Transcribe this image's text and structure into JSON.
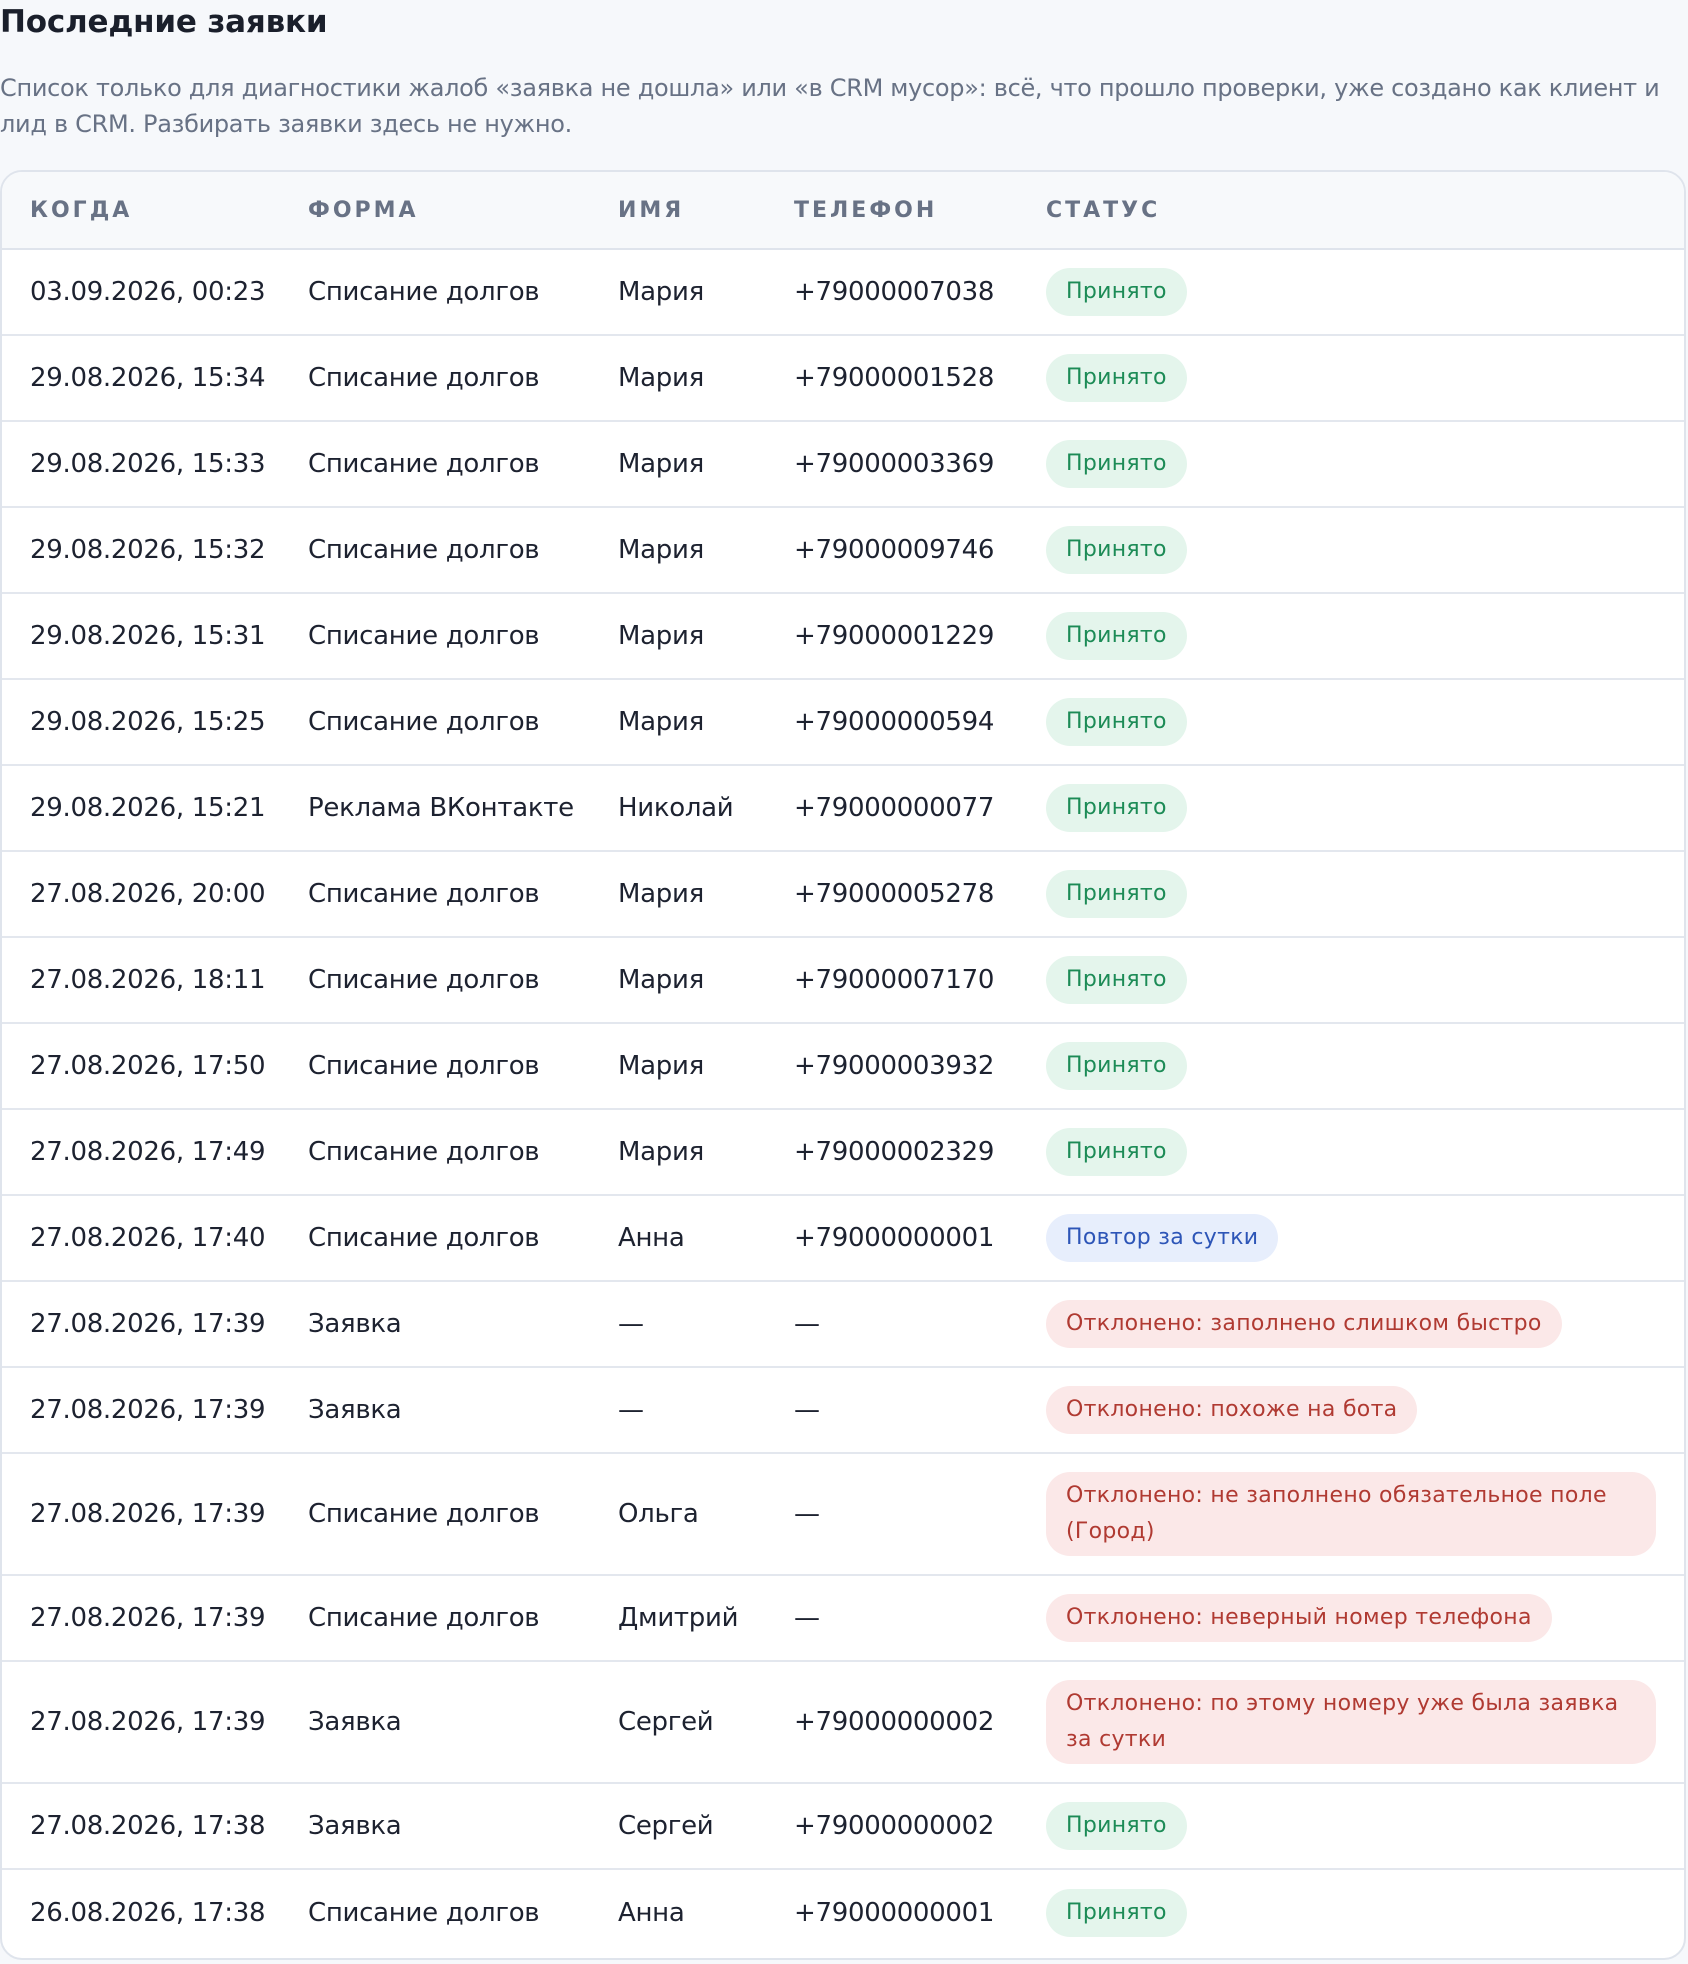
{
  "header": {
    "title": "Последние заявки",
    "description": "Список только для диагностики жалоб «заявка не дошла» или «в CRM мусор»: всё, что прошло проверки, уже создано как клиент и лид в CRM. Разбирать заявки здесь не нужно."
  },
  "table": {
    "columns": [
      "КОГДА",
      "ФОРМА",
      "ИМЯ",
      "ТЕЛЕФОН",
      "СТАТУС"
    ],
    "rows": [
      {
        "when": "03.09.2026, 00:23",
        "form": "Списание долгов",
        "name": "Мария",
        "phone": "+79000007038",
        "status": "Принято",
        "status_type": "accepted"
      },
      {
        "when": "29.08.2026, 15:34",
        "form": "Списание долгов",
        "name": "Мария",
        "phone": "+79000001528",
        "status": "Принято",
        "status_type": "accepted"
      },
      {
        "when": "29.08.2026, 15:33",
        "form": "Списание долгов",
        "name": "Мария",
        "phone": "+79000003369",
        "status": "Принято",
        "status_type": "accepted"
      },
      {
        "when": "29.08.2026, 15:32",
        "form": "Списание долгов",
        "name": "Мария",
        "phone": "+79000009746",
        "status": "Принято",
        "status_type": "accepted"
      },
      {
        "when": "29.08.2026, 15:31",
        "form": "Списание долгов",
        "name": "Мария",
        "phone": "+79000001229",
        "status": "Принято",
        "status_type": "accepted"
      },
      {
        "when": "29.08.2026, 15:25",
        "form": "Списание долгов",
        "name": "Мария",
        "phone": "+79000000594",
        "status": "Принято",
        "status_type": "accepted"
      },
      {
        "when": "29.08.2026, 15:21",
        "form": "Реклама ВКонтакте",
        "name": "Николай",
        "phone": "+79000000077",
        "status": "Принято",
        "status_type": "accepted"
      },
      {
        "when": "27.08.2026, 20:00",
        "form": "Списание долгов",
        "name": "Мария",
        "phone": "+79000005278",
        "status": "Принято",
        "status_type": "accepted"
      },
      {
        "when": "27.08.2026, 18:11",
        "form": "Списание долгов",
        "name": "Мария",
        "phone": "+79000007170",
        "status": "Принято",
        "status_type": "accepted"
      },
      {
        "when": "27.08.2026, 17:50",
        "form": "Списание долгов",
        "name": "Мария",
        "phone": "+79000003932",
        "status": "Принято",
        "status_type": "accepted"
      },
      {
        "when": "27.08.2026, 17:49",
        "form": "Списание долгов",
        "name": "Мария",
        "phone": "+79000002329",
        "status": "Принято",
        "status_type": "accepted"
      },
      {
        "when": "27.08.2026, 17:40",
        "form": "Списание долгов",
        "name": "Анна",
        "phone": "+79000000001",
        "status": "Повтор за сутки",
        "status_type": "repeat"
      },
      {
        "when": "27.08.2026, 17:39",
        "form": "Заявка",
        "name": "—",
        "phone": "—",
        "status": "Отклонено: заполнено слишком быстро",
        "status_type": "rejected"
      },
      {
        "when": "27.08.2026, 17:39",
        "form": "Заявка",
        "name": "—",
        "phone": "—",
        "status": "Отклонено: похоже на бота",
        "status_type": "rejected"
      },
      {
        "when": "27.08.2026, 17:39",
        "form": "Списание долгов",
        "name": "Ольга",
        "phone": "—",
        "status": "Отклонено: не заполнено обязательное поле (Город)",
        "status_type": "rejected",
        "tall": true
      },
      {
        "when": "27.08.2026, 17:39",
        "form": "Списание долгов",
        "name": "Дмитрий",
        "phone": "—",
        "status": "Отклонено: неверный номер телефона",
        "status_type": "rejected"
      },
      {
        "when": "27.08.2026, 17:39",
        "form": "Заявка",
        "name": "Сергей",
        "phone": "+79000000002",
        "status": "Отклонено: по этому номеру уже была заявка за сутки",
        "status_type": "rejected",
        "tall": true
      },
      {
        "when": "27.08.2026, 17:38",
        "form": "Заявка",
        "name": "Сергей",
        "phone": "+79000000002",
        "status": "Принято",
        "status_type": "accepted"
      },
      {
        "when": "26.08.2026, 17:38",
        "form": "Списание долгов",
        "name": "Анна",
        "phone": "+79000000001",
        "status": "Принято",
        "status_type": "accepted"
      }
    ]
  },
  "colors": {
    "accepted_bg": "#e4f5ec",
    "accepted_text": "#1c8b56",
    "repeat_bg": "#e7eefc",
    "repeat_text": "#2d55b7",
    "rejected_bg": "#fbe8e8",
    "rejected_text": "#b03a32"
  }
}
